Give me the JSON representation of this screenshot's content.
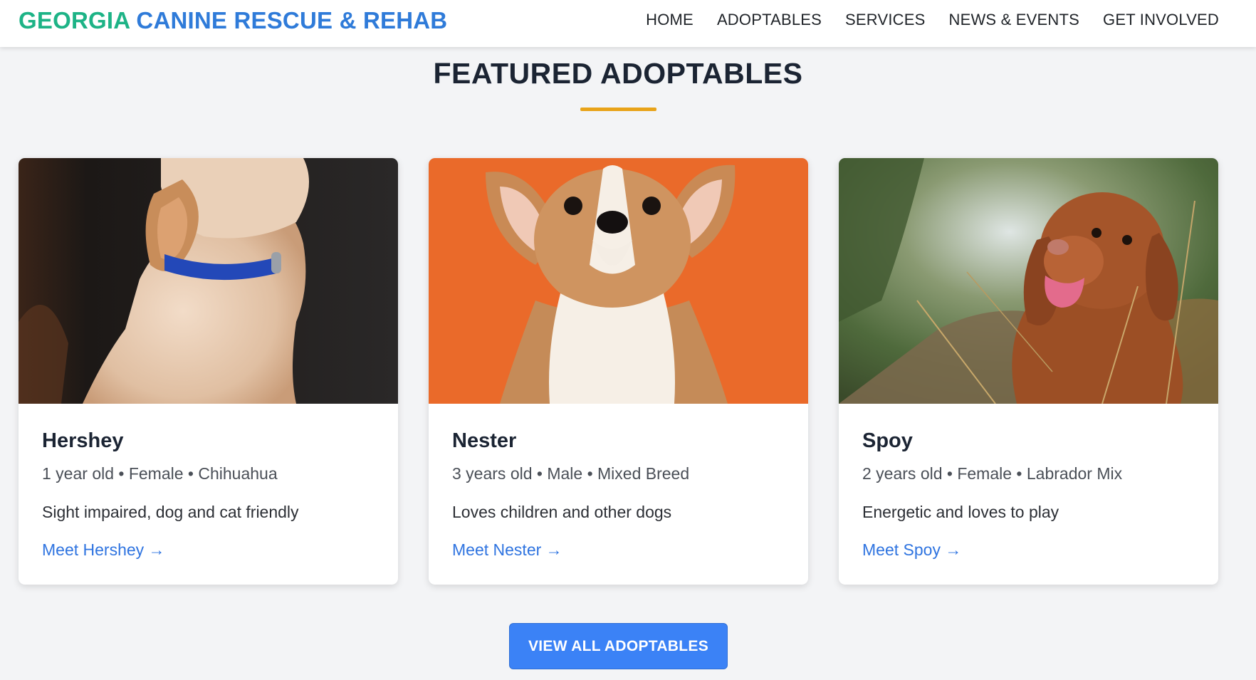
{
  "header": {
    "logo_part1": "GEORGIA",
    "logo_part2": "CANINE RESCUE & REHAB",
    "nav": [
      "HOME",
      "ADOPTABLES",
      "SERVICES",
      "NEWS & EVENTS",
      "GET INVOLVED"
    ]
  },
  "section": {
    "title": "FEATURED ADOPTABLES",
    "accent_color": "#e8a319"
  },
  "cards": [
    {
      "name": "Hershey",
      "meta": "1 year old • Female • Chihuahua",
      "description": "Sight impaired, dog and cat friendly",
      "link": "Meet Hershey →"
    },
    {
      "name": "Nester",
      "meta": "3 years old • Male • Mixed Breed",
      "description": "Loves children and other dogs",
      "link": "Meet Nester →"
    },
    {
      "name": "Spoy",
      "meta": "2 years old • Female • Labrador Mix",
      "description": "Energetic and loves to play",
      "link": "Meet Spoy →"
    }
  ],
  "cta": {
    "label": "VIEW ALL ADOPTABLES",
    "color": "#3b82f6"
  },
  "colors": {
    "brand_green": "#1db386",
    "brand_blue": "#2f7bd9",
    "link_blue": "#2f74e0"
  }
}
